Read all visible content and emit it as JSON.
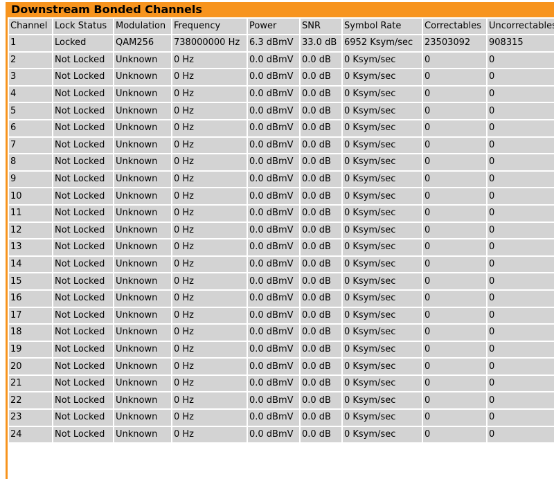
{
  "title": "Downstream Bonded Channels",
  "colors": {
    "accent": "#f7941e",
    "cell_background": "#d3d3d3",
    "text": "#000000"
  },
  "columns": [
    "Channel",
    "Lock Status",
    "Modulation",
    "Frequency",
    "Power",
    "SNR",
    "Symbol Rate",
    "Correctables",
    "Uncorrectables"
  ],
  "rows": [
    [
      "1",
      "Locked",
      "QAM256",
      "738000000 Hz",
      "6.3 dBmV",
      "33.0 dB",
      "6952 Ksym/sec",
      "23503092",
      "908315"
    ],
    [
      "2",
      "Not Locked",
      "Unknown",
      "0 Hz",
      "0.0 dBmV",
      "0.0 dB",
      "0 Ksym/sec",
      "0",
      "0"
    ],
    [
      "3",
      "Not Locked",
      "Unknown",
      "0 Hz",
      "0.0 dBmV",
      "0.0 dB",
      "0 Ksym/sec",
      "0",
      "0"
    ],
    [
      "4",
      "Not Locked",
      "Unknown",
      "0 Hz",
      "0.0 dBmV",
      "0.0 dB",
      "0 Ksym/sec",
      "0",
      "0"
    ],
    [
      "5",
      "Not Locked",
      "Unknown",
      "0 Hz",
      "0.0 dBmV",
      "0.0 dB",
      "0 Ksym/sec",
      "0",
      "0"
    ],
    [
      "6",
      "Not Locked",
      "Unknown",
      "0 Hz",
      "0.0 dBmV",
      "0.0 dB",
      "0 Ksym/sec",
      "0",
      "0"
    ],
    [
      "7",
      "Not Locked",
      "Unknown",
      "0 Hz",
      "0.0 dBmV",
      "0.0 dB",
      "0 Ksym/sec",
      "0",
      "0"
    ],
    [
      "8",
      "Not Locked",
      "Unknown",
      "0 Hz",
      "0.0 dBmV",
      "0.0 dB",
      "0 Ksym/sec",
      "0",
      "0"
    ],
    [
      "9",
      "Not Locked",
      "Unknown",
      "0 Hz",
      "0.0 dBmV",
      "0.0 dB",
      "0 Ksym/sec",
      "0",
      "0"
    ],
    [
      "10",
      "Not Locked",
      "Unknown",
      "0 Hz",
      "0.0 dBmV",
      "0.0 dB",
      "0 Ksym/sec",
      "0",
      "0"
    ],
    [
      "11",
      "Not Locked",
      "Unknown",
      "0 Hz",
      "0.0 dBmV",
      "0.0 dB",
      "0 Ksym/sec",
      "0",
      "0"
    ],
    [
      "12",
      "Not Locked",
      "Unknown",
      "0 Hz",
      "0.0 dBmV",
      "0.0 dB",
      "0 Ksym/sec",
      "0",
      "0"
    ],
    [
      "13",
      "Not Locked",
      "Unknown",
      "0 Hz",
      "0.0 dBmV",
      "0.0 dB",
      "0 Ksym/sec",
      "0",
      "0"
    ],
    [
      "14",
      "Not Locked",
      "Unknown",
      "0 Hz",
      "0.0 dBmV",
      "0.0 dB",
      "0 Ksym/sec",
      "0",
      "0"
    ],
    [
      "15",
      "Not Locked",
      "Unknown",
      "0 Hz",
      "0.0 dBmV",
      "0.0 dB",
      "0 Ksym/sec",
      "0",
      "0"
    ],
    [
      "16",
      "Not Locked",
      "Unknown",
      "0 Hz",
      "0.0 dBmV",
      "0.0 dB",
      "0 Ksym/sec",
      "0",
      "0"
    ],
    [
      "17",
      "Not Locked",
      "Unknown",
      "0 Hz",
      "0.0 dBmV",
      "0.0 dB",
      "0 Ksym/sec",
      "0",
      "0"
    ],
    [
      "18",
      "Not Locked",
      "Unknown",
      "0 Hz",
      "0.0 dBmV",
      "0.0 dB",
      "0 Ksym/sec",
      "0",
      "0"
    ],
    [
      "19",
      "Not Locked",
      "Unknown",
      "0 Hz",
      "0.0 dBmV",
      "0.0 dB",
      "0 Ksym/sec",
      "0",
      "0"
    ],
    [
      "20",
      "Not Locked",
      "Unknown",
      "0 Hz",
      "0.0 dBmV",
      "0.0 dB",
      "0 Ksym/sec",
      "0",
      "0"
    ],
    [
      "21",
      "Not Locked",
      "Unknown",
      "0 Hz",
      "0.0 dBmV",
      "0.0 dB",
      "0 Ksym/sec",
      "0",
      "0"
    ],
    [
      "22",
      "Not Locked",
      "Unknown",
      "0 Hz",
      "0.0 dBmV",
      "0.0 dB",
      "0 Ksym/sec",
      "0",
      "0"
    ],
    [
      "23",
      "Not Locked",
      "Unknown",
      "0 Hz",
      "0.0 dBmV",
      "0.0 dB",
      "0 Ksym/sec",
      "0",
      "0"
    ],
    [
      "24",
      "Not Locked",
      "Unknown",
      "0 Hz",
      "0.0 dBmV",
      "0.0 dB",
      "0 Ksym/sec",
      "0",
      "0"
    ]
  ]
}
